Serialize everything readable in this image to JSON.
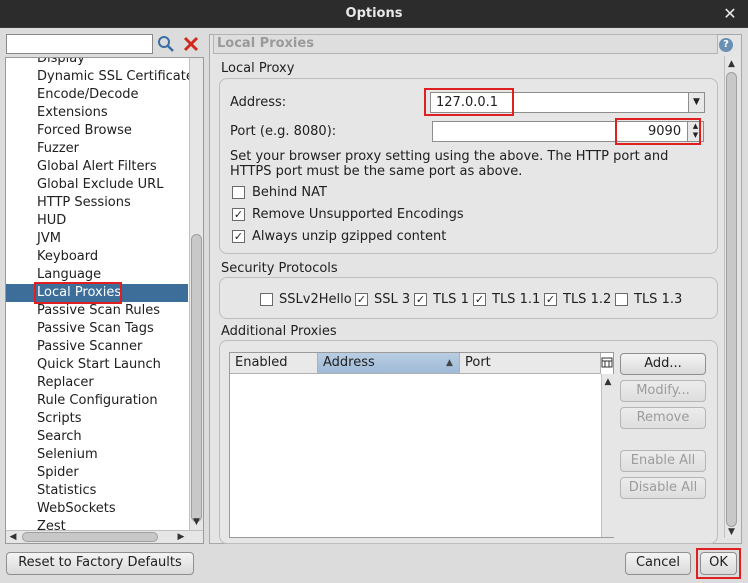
{
  "window": {
    "title": "Options",
    "close_label": "✕"
  },
  "sidebar": {
    "search_value": "",
    "items": [
      "Display",
      "Dynamic SSL Certificates",
      "Encode/Decode",
      "Extensions",
      "Forced Browse",
      "Fuzzer",
      "Global Alert Filters",
      "Global Exclude URL",
      "HTTP Sessions",
      "HUD",
      "JVM",
      "Keyboard",
      "Language",
      "Local Proxies",
      "Passive Scan Rules",
      "Passive Scan Tags",
      "Passive Scanner",
      "Quick Start Launch",
      "Replacer",
      "Rule Configuration",
      "Scripts",
      "Search",
      "Selenium",
      "Spider",
      "Statistics",
      "WebSockets",
      "Zest"
    ],
    "selected": "Local Proxies"
  },
  "panel": {
    "title": "Local Proxies",
    "help_label": "?",
    "local_proxy": {
      "group_title": "Local Proxy",
      "address_label": "Address:",
      "address_value": "127.0.0.1",
      "port_label": "Port (e.g. 8080):",
      "port_value": "9090",
      "help_text_1": "Set your browser proxy setting using the above.  The HTTP port and",
      "help_text_2": "HTTPS port must be the same port as above.",
      "options": [
        {
          "label": "Behind NAT",
          "checked": false
        },
        {
          "label": "Remove Unsupported Encodings",
          "checked": true
        },
        {
          "label": "Always unzip gzipped content",
          "checked": true
        }
      ]
    },
    "security": {
      "group_title": "Security Protocols",
      "protocols": [
        {
          "label": "SSLv2Hello",
          "checked": false
        },
        {
          "label": "SSL 3",
          "checked": true
        },
        {
          "label": "TLS 1",
          "checked": true
        },
        {
          "label": "TLS 1.1",
          "checked": true
        },
        {
          "label": "TLS 1.2",
          "checked": true
        },
        {
          "label": "TLS 1.3",
          "checked": false
        }
      ]
    },
    "additional": {
      "group_title": "Additional Proxies",
      "columns": [
        "Enabled",
        "Address",
        "Port"
      ],
      "sort_indicator": "▲",
      "buttons": {
        "add": "Add...",
        "modify": "Modify...",
        "remove": "Remove",
        "enable_all": "Enable All",
        "disable_all": "Disable All"
      }
    }
  },
  "footer": {
    "reset": "Reset to Factory Defaults",
    "cancel": "Cancel",
    "ok": "OK"
  },
  "colors": {
    "selection": "#3c6e99",
    "highlight": "#e02020"
  }
}
